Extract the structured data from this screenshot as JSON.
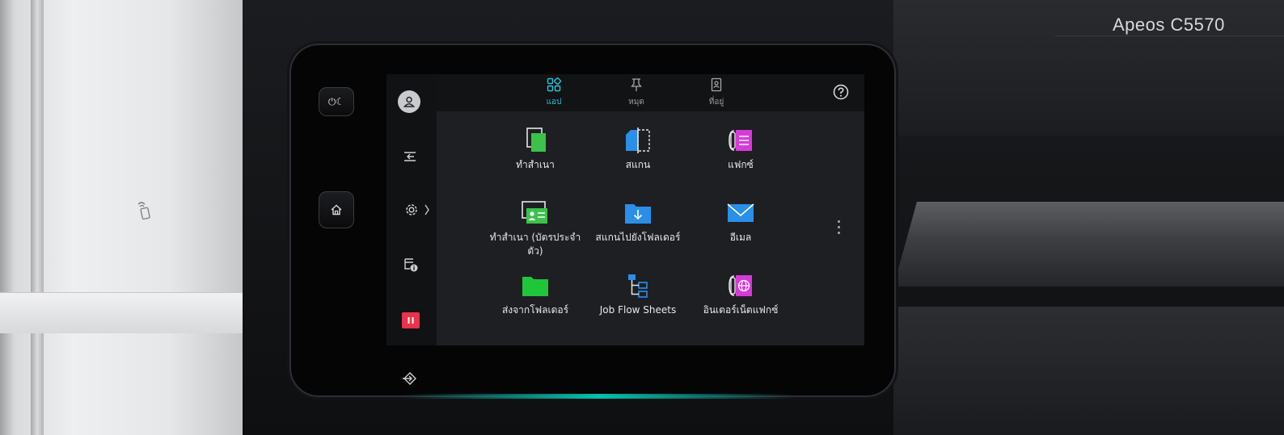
{
  "device": {
    "model": "Apeos C5570"
  },
  "hardware_buttons": {
    "power_label": "⏻☾"
  },
  "tabs": [
    {
      "label": "แอป",
      "active": true,
      "icon": "apps-grid-icon"
    },
    {
      "label": "หมุด",
      "active": false,
      "icon": "pin-icon"
    },
    {
      "label": "ที่อยู่",
      "active": false,
      "icon": "address-book-icon"
    }
  ],
  "tiles": [
    {
      "label": "ทำสำเนา",
      "icon": "copy-icon"
    },
    {
      "label": "สแกน",
      "icon": "scan-icon"
    },
    {
      "label": "แฟกซ์",
      "icon": "fax-icon"
    },
    {
      "label": "ทำสำเนา (บัตรประจำตัว)",
      "label_line1": "ทำสำเนา (บัตรประจำ",
      "label_line2": "ตัว)",
      "icon": "id-card-copy-icon"
    },
    {
      "label": "สแกนไปยังโฟลเดอร์",
      "icon": "scan-to-folder-icon"
    },
    {
      "label": "อีเมล",
      "icon": "email-icon"
    },
    {
      "label": "ส่งจากโฟลเดอร์",
      "icon": "send-from-folder-icon"
    },
    {
      "label": "Job Flow Sheets",
      "icon": "job-flow-icon"
    },
    {
      "label": "อินเตอร์เน็ตแฟกซ์",
      "icon": "internet-fax-icon"
    }
  ],
  "colors": {
    "active_tab": "#27c3d9",
    "copy": "#3cc14b",
    "scan": "#2a8fe8",
    "fax": "#d63ad8",
    "email": "#2a8fe8",
    "folder": "#20c63a",
    "interrupt": "#e8334a"
  }
}
